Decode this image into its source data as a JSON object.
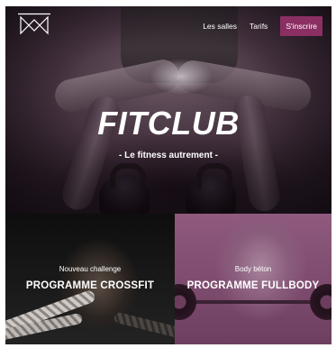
{
  "brand": {
    "logo_icon": "fitclub-logo-icon"
  },
  "nav": {
    "links": [
      {
        "label": "Les salles"
      },
      {
        "label": "Tarifs"
      }
    ],
    "cta_label": "S'inscrire"
  },
  "hero": {
    "title": "FITCLUB",
    "subtitle": "- Le fitness autrement -"
  },
  "cards": [
    {
      "kicker": "Nouveau challenge",
      "title": "PROGRAMME CROSSFIT"
    },
    {
      "kicker": "Body béton",
      "title": "PROGRAMME FULLBODY"
    }
  ],
  "colors": {
    "accent": "#8b2f63",
    "card_fullbody_tint": "#7e4a6c"
  }
}
